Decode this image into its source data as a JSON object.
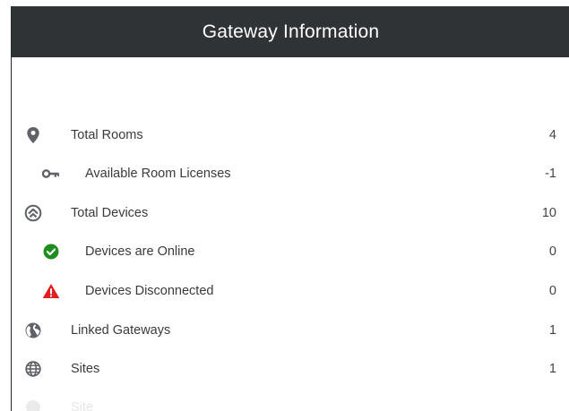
{
  "header": {
    "title": "Gateway Information"
  },
  "rows": [
    {
      "label": "Total Rooms",
      "value": "4",
      "icon": "location-pin-icon"
    },
    {
      "label": "Available Room Licenses",
      "value": "-1",
      "icon": "key-icon"
    },
    {
      "label": "Total Devices",
      "value": "10",
      "icon": "devices-icon"
    },
    {
      "label": "Devices are Online",
      "value": "0",
      "icon": "check-circle-icon",
      "color": "#1e8e1e"
    },
    {
      "label": "Devices Disconnected",
      "value": "0",
      "icon": "warning-icon",
      "color": "#e02020"
    },
    {
      "label": "Linked Gateways",
      "value": "1",
      "icon": "globe-icon"
    },
    {
      "label": "Sites",
      "value": "1",
      "icon": "sites-icon"
    },
    {
      "label": "Site",
      "value": "",
      "icon": "site-icon"
    }
  ]
}
